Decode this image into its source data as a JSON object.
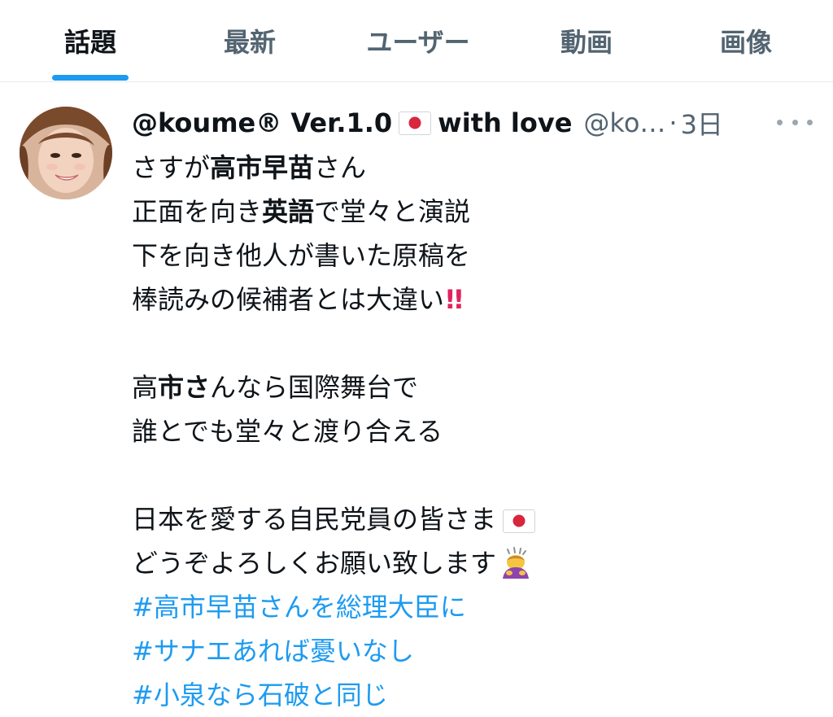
{
  "tabs": [
    {
      "label": "話題",
      "active": true
    },
    {
      "label": "最新",
      "active": false
    },
    {
      "label": "ユーザー",
      "active": false
    },
    {
      "label": "動画",
      "active": false
    },
    {
      "label": "画像",
      "active": false
    }
  ],
  "tweet": {
    "display_name": "@koume® Ver.1.0",
    "display_name_suffix": "with love",
    "handle": "@ko…",
    "separator": "·",
    "time": "3日",
    "lines": {
      "l1a": "さすが",
      "l1b": "高市早苗",
      "l1c": "さん",
      "l2a": "正面を向き",
      "l2b": "英語",
      "l2c": "で堂々と演説",
      "l3": "下を向き他人が書いた原稿を",
      "l4": "棒読みの候補者とは大違い",
      "l4_emoji": "!!",
      "l5a": "高",
      "l5b": "市さ",
      "l5c": "んなら国際舞台で",
      "l6": "誰とでも堂々と渡り合える",
      "l7": "日本を愛する自民党員の皆さま",
      "l8": "どうぞよろしくお願い致します"
    },
    "hashtags": [
      "#高市早苗さんを総理大臣に",
      "#サナエあれば憂いなし",
      "#小泉なら石破と同じ"
    ]
  },
  "colors": {
    "accent": "#1d9bf0",
    "text": "#0f1419",
    "muted": "#536471",
    "flag_red": "#d7263d"
  },
  "icons": {
    "more": "more-horizontal-icon",
    "flag": "japan-flag-icon",
    "bow": "person-bowing-icon",
    "exclaim": "double-exclamation-icon"
  }
}
